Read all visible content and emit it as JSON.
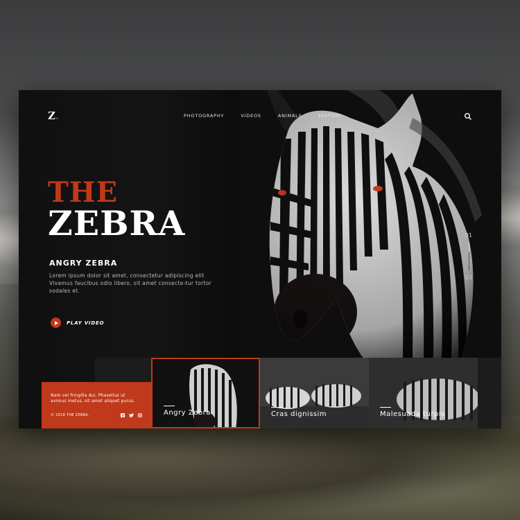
{
  "brand": {
    "logo_letter": "Z",
    "logo_dot": ".",
    "accent": "#c0391b"
  },
  "nav": {
    "items": [
      "PHOTOGRAPHY",
      "VIDEOS",
      "ANIMALS",
      "HISTORY"
    ]
  },
  "hero": {
    "title_top": "THE",
    "title_main": "ZEBRA",
    "subtitle": "ANGRY ZEBRA",
    "description": "Lorem ipsum dolor sit amet, consectetur adipiscing elit Vivamus faucibus odio libero, sit amet consecte-tur tortor sodales et.",
    "play_label": "PLAY VIDEO"
  },
  "pager": {
    "current": "01",
    "total": "03",
    "progress": 0.33
  },
  "footer": {
    "text": "Nam vel fringilla dui. Phasellus ut aximus metus, sit amet aliquet purus.",
    "copyright": "© 2018 THE ZEBRA.",
    "social_icons": [
      "facebook-icon",
      "twitter-icon",
      "instagram-icon"
    ]
  },
  "thumbnails": [
    {
      "label": "Angry Zebra",
      "active": true
    },
    {
      "label": "Cras dignissim",
      "active": false
    },
    {
      "label": "Malesuada turpis",
      "active": false
    }
  ]
}
